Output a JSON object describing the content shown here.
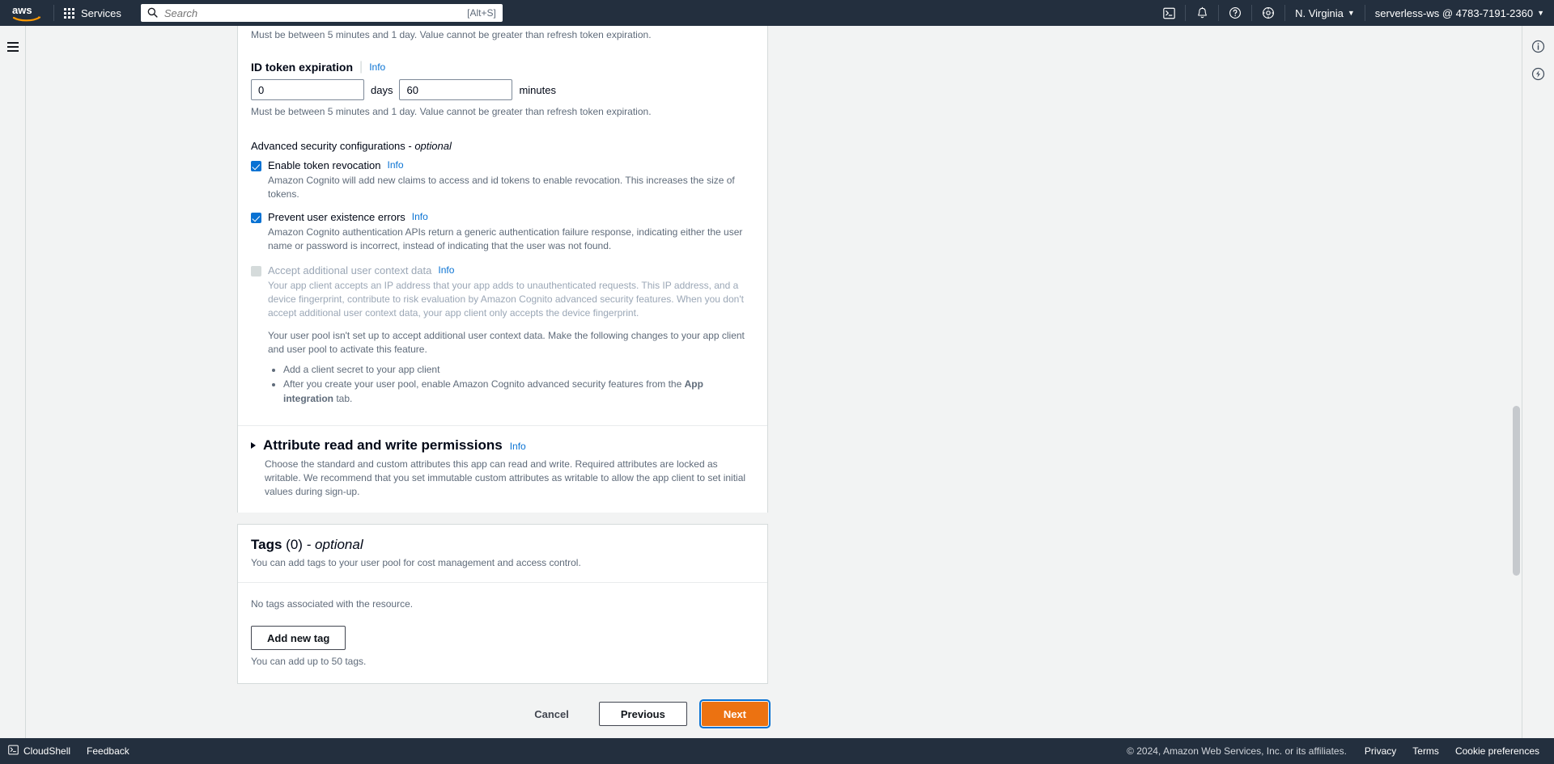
{
  "topnav": {
    "logo_alt": "aws",
    "services_label": "Services",
    "search_placeholder": "Search",
    "search_value": "",
    "search_shortcut": "[Alt+S]",
    "icons": [
      "cloudshell-icon",
      "notifications-bell-icon",
      "help-question-icon",
      "settings-gear-icon"
    ],
    "region_label": "N. Virginia",
    "account_label": "serverless-ws @ 4783-7191-2360"
  },
  "left_rail": {
    "menu_label": "hamburger-menu-icon"
  },
  "right_rail": {
    "info_label": "info-panel-icon",
    "shortcut_label": "shortcut-panel-icon"
  },
  "form": {
    "access_token_hint": "Must be between 5 minutes and 1 day. Value cannot be greater than refresh token expiration.",
    "id_token": {
      "label": "ID token expiration",
      "info": "Info",
      "days_value": "0",
      "days_unit": "days",
      "minutes_value": "60",
      "minutes_unit": "minutes",
      "hint": "Must be between 5 minutes and 1 day. Value cannot be greater than refresh token expiration."
    },
    "advanced_security": {
      "title": "Advanced security configurations - ",
      "title_optional": "optional",
      "options": [
        {
          "label": "Enable token revocation",
          "info": "Info",
          "checked": true,
          "disabled": false,
          "description": "Amazon Cognito will add new claims to access and id tokens to enable revocation. This increases the size of tokens."
        },
        {
          "label": "Prevent user existence errors",
          "info": "Info",
          "checked": true,
          "disabled": false,
          "description": "Amazon Cognito authentication APIs return a generic authentication failure response, indicating either the user name or password is incorrect, instead of indicating that the user was not found."
        },
        {
          "label": "Accept additional user context data",
          "info": "Info",
          "checked": false,
          "disabled": true,
          "description": "Your app client accepts an IP address that your app adds to unauthenticated requests. This IP address, and a device fingerprint, contribute to risk evaluation by Amazon Cognito advanced security features. When you don't accept additional user context data, your app client only accepts the device fingerprint."
        }
      ],
      "note": "Your user pool isn't set up to accept additional user context data. Make the following changes to your app client and user pool to activate this feature.",
      "bullets": [
        {
          "pre": "Add a client secret to your app client",
          "bold": "",
          "post": ""
        },
        {
          "pre": "After you create your user pool, enable Amazon Cognito advanced security features from the ",
          "bold": "App integration",
          "post": " tab."
        }
      ]
    },
    "attribute_permissions": {
      "title": "Attribute read and write permissions",
      "info": "Info",
      "description": "Choose the standard and custom attributes this app can read and write. Required attributes are locked as writable. We recommend that you set immutable custom attributes as writable to allow the app client to set initial values during sign-up.",
      "expanded": false
    },
    "tags": {
      "title": "Tags",
      "count": "(0)",
      "optional": "- optional",
      "description": "You can add tags to your user pool for cost management and access control.",
      "empty_text": "No tags associated with the resource.",
      "add_button": "Add new tag",
      "limit_text": "You can add up to 50 tags."
    },
    "actions": {
      "cancel": "Cancel",
      "previous": "Previous",
      "next": "Next"
    }
  },
  "footer": {
    "cloudshell": "CloudShell",
    "feedback": "Feedback",
    "copyright": "© 2024, Amazon Web Services, Inc. or its affiliates.",
    "privacy": "Privacy",
    "terms": "Terms",
    "cookie_preferences": "Cookie preferences"
  },
  "colors": {
    "nav_bg": "#232f3e",
    "accent_link": "#0972d3",
    "primary_button": "#ec7211",
    "page_bg": "#f2f3f3"
  }
}
